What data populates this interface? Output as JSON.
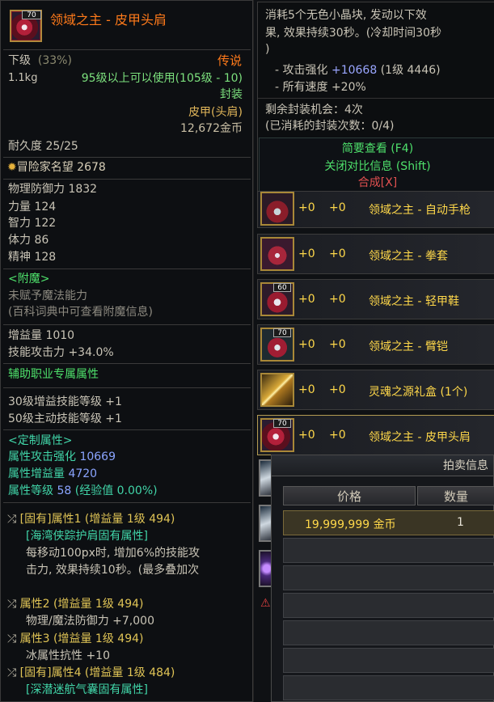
{
  "left": {
    "icon_level": "70",
    "item_name": "领域之主 - 皮甲头肩",
    "grade": "下级",
    "grade_pct": "(33%)",
    "rarity": "传说",
    "weight": "1.1kg",
    "level_req": "95级以上可以使用(105级 - 10)",
    "sealed": "封装",
    "type": "皮甲(头肩)",
    "price": "12,672金币",
    "durability": "耐久度 25/25",
    "fame": "冒险家名望 2678",
    "stats": [
      {
        "label": "物理防御力",
        "value": "1832"
      },
      {
        "label": "力量",
        "value": "124"
      },
      {
        "label": "智力",
        "value": "122"
      },
      {
        "label": "体力",
        "value": "86"
      },
      {
        "label": "精神",
        "value": "128"
      }
    ],
    "enchant_title": "<附魔>",
    "enchant_line1": "未赋予魔法能力",
    "enchant_line2": "(百科词典中可查看附魔信息)",
    "buff_amount": "增益量 1010",
    "skill_atk": "技能攻击力 +34.0%",
    "support_title": "辅助职业专属属性",
    "support_lines": [
      "30级增益技能等级 +1",
      "50级主动技能等级 +1"
    ],
    "custom_title": "<定制属性>",
    "custom_attr_atk_label": "属性攻击强化",
    "custom_attr_atk_value": "10669",
    "custom_buff_label": "属性增益量",
    "custom_buff_value": "4720",
    "custom_level_label": "属性等级",
    "custom_level_value": "58",
    "custom_level_exp": "(经验值 0.00%)",
    "attr1_head": "[固有]属性1 (增益量 1级 494)",
    "attr1_sub": "[海湾侠踪护肩固有属性]",
    "attr1_desc": [
      "每移动100px时, 增加6%的技能攻",
      "击力, 效果持续10秒。(最多叠加次"
    ],
    "attr2_head": "属性2 (增益量 1级 494)",
    "attr2_desc": "物理/魔法防御力 +7,000",
    "attr3_head": "属性3 (增益量 1级 494)",
    "attr3_desc": "冰属性抗性 +10",
    "attr4_head": "[固有]属性4 (增益量 1级 484)",
    "attr4_sub": "[深潜迷航气囊固有属性]"
  },
  "right": {
    "seal_desc": [
      "消耗5个无色小晶块, 发动以下效",
      "果, 效果持续30秒。(冷却时间30秒",
      ")"
    ],
    "seal_atk_label": "- 攻击强化",
    "seal_atk_value": "+10668",
    "seal_atk_extra": "(1级 4446)",
    "seal_speed": "- 所有速度 +20%",
    "seal_remaining": "剩余封装机会：4次",
    "seal_used": "(已消耗的封装次数：0/4)",
    "menu": {
      "simple_view": "简要查看 (F4)",
      "close_compare": "关闭对比信息 (Shift)",
      "synth": "合成[X]"
    },
    "inventory": [
      {
        "plus1": "+0",
        "plus2": "+0",
        "name": "领域之主 - 自动手枪",
        "badge": ""
      },
      {
        "plus1": "+0",
        "plus2": "+0",
        "name": "领域之主 - 拳套",
        "badge": ""
      },
      {
        "plus1": "+0",
        "plus2": "+0",
        "name": "领域之主 - 轻甲鞋",
        "badge": "60"
      },
      {
        "plus1": "+0",
        "plus2": "+0",
        "name": "领域之主 - 臂铠",
        "badge": "70"
      },
      {
        "plus1": "+0",
        "plus2": "+0",
        "name": "灵魂之源礼盒 (1个)",
        "badge": ""
      },
      {
        "plus1": "+0",
        "plus2": "+0",
        "name": "领域之主 - 皮甲头肩",
        "badge": "70"
      }
    ],
    "auction": {
      "title": "拍卖信息",
      "col_price": "价格",
      "col_qty": "数量",
      "row_price": "19,999,999 金币",
      "row_qty": "1"
    }
  },
  "colors": {
    "item_name": "#ff7a1a",
    "legend": "#ff7a1a",
    "inventory_text": "#ffd84a",
    "support": "#4ee06b",
    "custom_value": "#8aa4ff",
    "synth": "#e05050"
  }
}
